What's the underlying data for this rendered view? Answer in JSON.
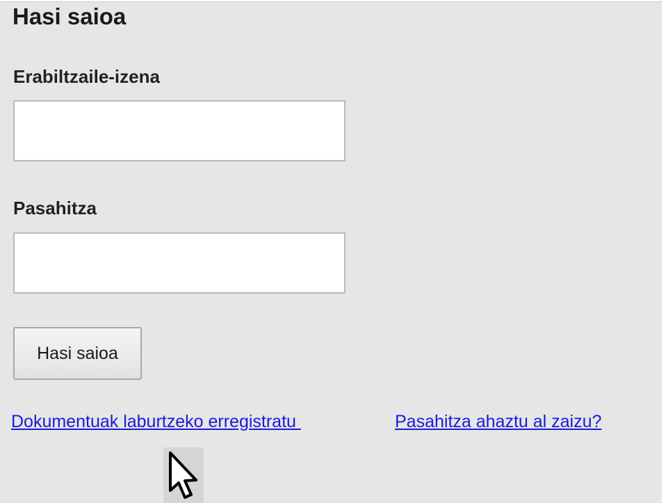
{
  "login": {
    "heading": "Hasi saioa",
    "username_label": "Erabiltzaile-izena",
    "username_value": "",
    "password_label": "Pasahitza",
    "password_value": "",
    "submit_label": "Hasi saioa"
  },
  "links": {
    "register": "Dokumentuak laburtzeko erregistratu ",
    "forgot_password": "Pasahitza ahaztu al zaizu?"
  },
  "icons": {
    "cursor": "mouse-pointer-icon"
  },
  "colors": {
    "panel_background": "#e6e6e6",
    "link": "#1a1adb",
    "input_border": "#b9b9b9"
  }
}
